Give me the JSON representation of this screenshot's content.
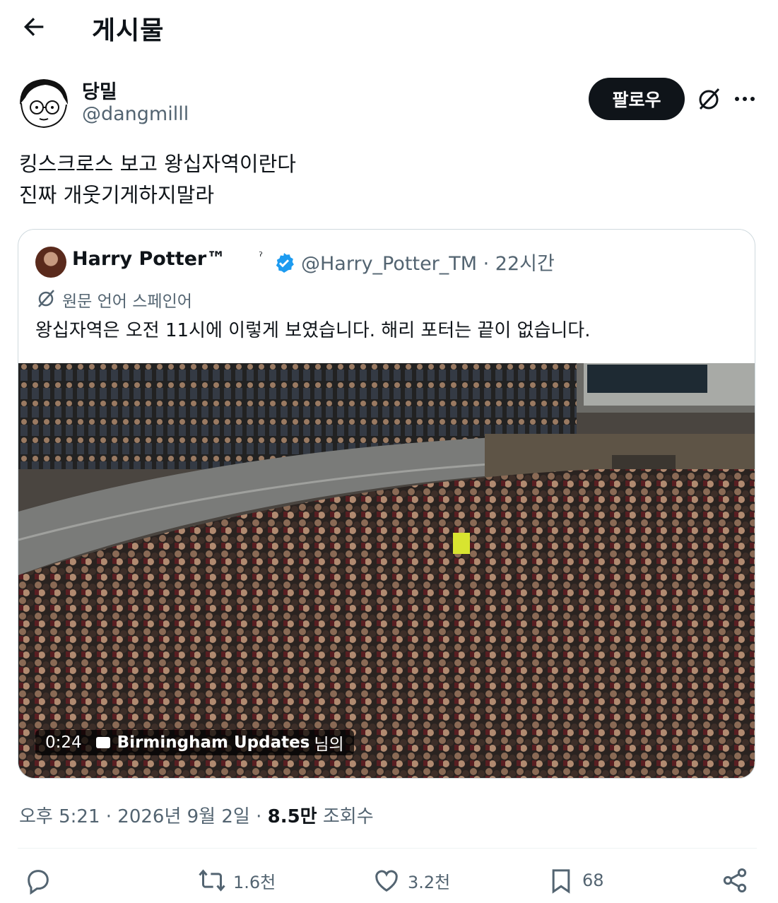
{
  "header": {
    "title": "게시물"
  },
  "post": {
    "display_name": "당밀",
    "handle": "@dangmilll",
    "follow_label": "팔로우",
    "lines": [
      "킹스크로스 보고 왕십자역이란다",
      "진짜 개웃기게하지말라"
    ],
    "timestamp": "오후 5:21 · 2026년 9월 2일 · ",
    "views_count": "8.5만",
    "views_label": " 조회수"
  },
  "quote": {
    "name": "Harry Potter™",
    "handle_time": "@Harry_Potter_TM · 22시간",
    "translated_from": "원문 언어 스페인어",
    "text": "왕십자역은 오전 11시에 이렇게 보였습니다. 해리 포터는 끝이 없습니다.",
    "video": {
      "duration": "0:24",
      "source": "Birmingham Updates",
      "source_suffix": "님의"
    }
  },
  "actions": {
    "reply": "",
    "retweet": "1.6천",
    "like": "3.2천",
    "bookmark": "68"
  },
  "colors": {
    "text": "#0f1419",
    "secondary": "#536471",
    "verified": "#1d9bf0",
    "border": "#cfd9de"
  },
  "icons": [
    "back-arrow-icon",
    "grok-icon",
    "more-icon",
    "verified-icon",
    "translate-icon",
    "reply-icon",
    "retweet-icon",
    "like-icon",
    "bookmark-icon",
    "share-icon"
  ]
}
